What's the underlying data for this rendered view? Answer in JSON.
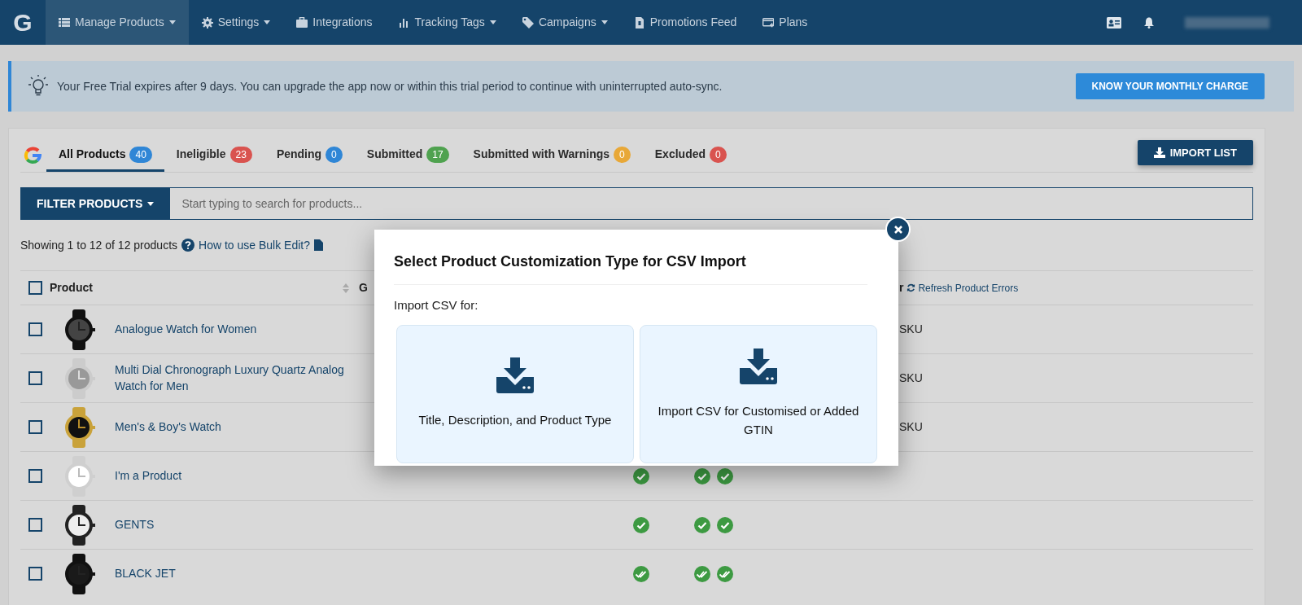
{
  "navbar": {
    "logo": "G",
    "items": [
      {
        "label": "Manage Products",
        "has_menu": true,
        "selected": true
      },
      {
        "label": "Settings",
        "has_menu": true,
        "selected": false
      },
      {
        "label": "Integrations",
        "has_menu": false,
        "selected": false
      },
      {
        "label": "Tracking Tags",
        "has_menu": true,
        "selected": false
      },
      {
        "label": "Campaigns",
        "has_menu": true,
        "selected": false
      },
      {
        "label": "Promotions Feed",
        "has_menu": false,
        "selected": false
      },
      {
        "label": "Plans",
        "has_menu": false,
        "selected": false
      }
    ]
  },
  "trial_alert": {
    "text": "Your Free Trial expires after 9 days. You can upgrade the app now or within this trial period to continue with uninterrupted auto-sync.",
    "button": "KNOW YOUR MONTHLY CHARGE"
  },
  "tabs": [
    {
      "label": "All Products",
      "count": "40",
      "color": "#2f86d6",
      "selected": true
    },
    {
      "label": "Ineligible",
      "count": "23",
      "color": "#d9534f",
      "selected": false
    },
    {
      "label": "Pending",
      "count": "0",
      "color": "#2f86d6",
      "selected": false
    },
    {
      "label": "Submitted",
      "count": "17",
      "color": "#4fa24f",
      "selected": false
    },
    {
      "label": "Submitted with Warnings",
      "count": "0",
      "color": "#e8a838",
      "selected": false
    },
    {
      "label": "Excluded",
      "count": "0",
      "color": "#d9534f",
      "selected": false
    }
  ],
  "import_button": "IMPORT LIST",
  "filter": {
    "button": "FILTER PRODUCTS",
    "placeholder": "Start typing to search for products..."
  },
  "summary": {
    "text": "Showing 1 to 12 of 12 products",
    "help_link": "How to use Bulk Edit?"
  },
  "table": {
    "columns": [
      {
        "label": "Product"
      },
      {
        "label": "G"
      },
      {
        "label": "r"
      }
    ],
    "refresh_link": "Refresh Product Errors",
    "header_checked": false,
    "rows": [
      {
        "name": "Analogue Watch for Women",
        "checked": false,
        "sku": "SKU"
      },
      {
        "name": "Multi Dial Chronograph Luxury Quartz Analog Watch for Men",
        "checked": false,
        "sku": "SKU"
      },
      {
        "name": "Men's & Boy's Watch",
        "checked": false,
        "sku": "SKU"
      },
      {
        "name": "I'm a Product",
        "checked": false,
        "checks": [
          {
            "kind": "check"
          },
          {
            "kind": "check"
          },
          {
            "kind": "check"
          }
        ]
      },
      {
        "name": "GENTS",
        "checked": false,
        "checks": [
          {
            "kind": "check"
          },
          {
            "kind": "check"
          },
          {
            "kind": "check"
          }
        ]
      },
      {
        "name": "BLACK JET",
        "checked": false,
        "checks": [
          {
            "kind": "double-check"
          },
          {
            "kind": "double-check"
          },
          {
            "kind": "double-check"
          }
        ]
      }
    ]
  },
  "modal": {
    "title": "Select Product Customization Type for CSV Import",
    "subtitle": "Import CSV for:",
    "options": [
      {
        "label": "Title, Description, and Product Type"
      },
      {
        "label": "Import CSV for Customised or Added GTIN"
      }
    ]
  }
}
